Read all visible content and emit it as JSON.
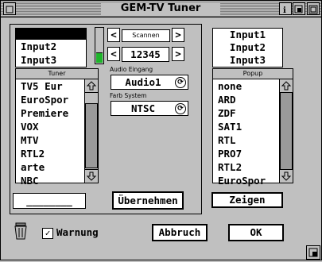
{
  "window": {
    "title": "GEM-TV Tuner"
  },
  "titlebar": {
    "close_icon": "close-icon",
    "info_icon": "info-icon",
    "iconify_icon": "iconify-icon",
    "fullscreen_icon": "fullscreen-icon"
  },
  "inputs": {
    "items": [
      "",
      "Input2",
      "Input3"
    ],
    "selected_index": 0
  },
  "channel": {
    "scan_label": "Scannen",
    "frequency": "12345",
    "left_arrow": "<",
    "right_arrow": ">"
  },
  "tuner_list": {
    "header": "Tuner",
    "items": [
      "TV5 Eur",
      "EuroSpor",
      "Premiere",
      "VOX",
      "MTV",
      "RTL2",
      "arte",
      "NBC"
    ]
  },
  "audio": {
    "label": "Audio Eingang",
    "value": "Audio1"
  },
  "color_system": {
    "label": "Farb System",
    "value": "NTSC"
  },
  "name_field": {
    "value": "________"
  },
  "apply_button": "Übernehmen",
  "right_inputs": {
    "items": [
      "Input1",
      "Input2",
      "Input3"
    ]
  },
  "popup_list": {
    "header": "Popup",
    "items": [
      "none",
      "ARD",
      "ZDF",
      "SAT1",
      "RTL",
      "PRO7",
      "RTL2",
      "EuroSpor"
    ]
  },
  "show_button": "Zeigen",
  "warning": {
    "label": "Warnung",
    "checked": true,
    "check_mark": "✓"
  },
  "cancel_button": "Abbruch",
  "ok_button": "OK",
  "icons": {
    "trash": "trash-icon",
    "resize": "resize-icon"
  }
}
